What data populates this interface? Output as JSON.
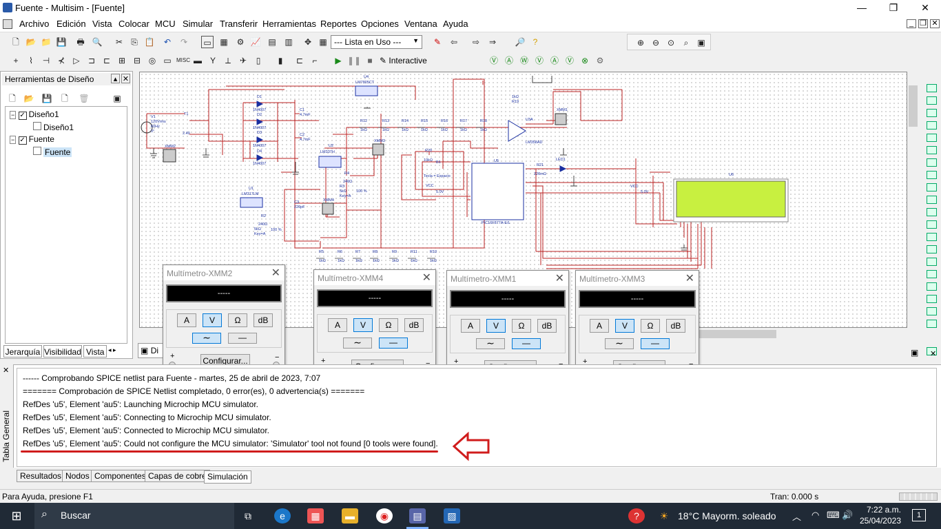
{
  "window": {
    "title": "Fuente - Multisim - [Fuente]",
    "min": "—",
    "max": "❐",
    "close": "✕"
  },
  "menu": [
    "Archivo",
    "Edición",
    "Vista",
    "Colocar",
    "MCU",
    "Simular",
    "Transferir",
    "Herramientas",
    "Reportes",
    "Opciones",
    "Ventana",
    "Ayuda"
  ],
  "toolbar": {
    "combo": "--- Lista en Uso ---",
    "interactive": "Interactive"
  },
  "design_tools": {
    "title": "Herramientas de Diseño",
    "tree": [
      "Diseño1",
      "Diseño1",
      "Fuente",
      "Fuente"
    ],
    "tabs": [
      "Jerarquía",
      "Visibilidad",
      "Vista d"
    ]
  },
  "schematic": {
    "tab": "Di",
    "labels": {
      "v1": "V1",
      "v1a": "120Vrms",
      "v1b": "60Hz",
      "v1c": "0°",
      "t1": "T1",
      "t1v": "2.49",
      "d1": "D1",
      "d2": "D2",
      "d3": "D3",
      "d4": "D4",
      "dmodel": "1N4007",
      "c1": "C1",
      "c1v": "4.7mF",
      "c2": "C2",
      "c2v": "4.7mF",
      "c3": "C3",
      "c3v": "220pF",
      "u4": "U4",
      "u4m": "LM7805CT",
      "u2": "U2",
      "u2m": "LM337H",
      "u1": "U1",
      "u1m": "LM317LM",
      "r4": "R4",
      "r4v": "240Ω",
      "r3": "R3",
      "r3v": "5kΩ",
      "r3k": "Key=A",
      "r3p": "100 %",
      "r2": "R2",
      "r2v": "240Ω",
      "r1": "R1",
      "r1v": "5kΩ",
      "r1k": "Key=A",
      "r1p": "100 %",
      "r12": "R12",
      "r13": "R13",
      "r14": "R14",
      "r15": "R15",
      "r16": "R16",
      "r17": "R17",
      "r18": "R18",
      "kohm": "1kΩ",
      "r5": "R5",
      "r6": "R6",
      "r7": "R7",
      "r8": "R8",
      "r9": "R9",
      "r11": "R11",
      "r10": "R10",
      "r19": "R19",
      "r19v": "1kΩ",
      "u3": "U3A",
      "u3m": "LM358AD",
      "xmm1": "XMM1",
      "xmm2": "XMM2",
      "xmm3": "XMM3",
      "xmm4": "XMM4",
      "r20": "R20",
      "r20v": "10kΩ",
      "b1": "B1",
      "b1k": "Tecla = Espacio",
      "vcc": "VCC",
      "vccv": "5.0V",
      "u5": "U5",
      "u5m": "PIC16F877A-E/L",
      "led1": "LED1",
      "r21": "R21",
      "r21v": "220mΩ",
      "u6": "U6",
      "vcc2": "VCC",
      "vcc2v": "5.0V"
    }
  },
  "multimeters": [
    {
      "title": "Multímetro-XMM2",
      "display": "-----",
      "buttons": [
        "A",
        "V",
        "Ω",
        "dB"
      ],
      "active": 1,
      "wave_active": 0,
      "config": "Configurar...",
      "plus": "+",
      "minus": "−"
    },
    {
      "title": "Multímetro-XMM4",
      "display": "-----",
      "buttons": [
        "A",
        "V",
        "Ω",
        "dB"
      ],
      "active": 1,
      "wave_active": 1,
      "config": "Configurar...",
      "plus": "+",
      "minus": "−"
    },
    {
      "title": "Multímetro-XMM1",
      "display": "-----",
      "buttons": [
        "A",
        "V",
        "Ω",
        "dB"
      ],
      "active": 1,
      "wave_active": 1,
      "config": "Configurar...",
      "plus": "+",
      "minus": "−"
    },
    {
      "title": "Multímetro-XMM3",
      "display": "-----",
      "buttons": [
        "A",
        "V",
        "Ω",
        "dB"
      ],
      "active": 1,
      "wave_active": 1,
      "config": "Configurar...",
      "plus": "+",
      "minus": "−"
    }
  ],
  "output": {
    "vertical_tab": "Tabla General",
    "lines": [
      "------ Comprobando SPICE netlist para Fuente - martes, 25 de abril de 2023, 7:07",
      "======= Comprobación de SPICE Netlist completado, 0 error(es), 0 advertencia(s) =======",
      "RefDes 'u5', Element 'au5': Launching Microchip MCU simulator.",
      "RefDes 'u5', Element 'au5': Connecting to Microchip MCU simulator.",
      "RefDes 'u5', Element 'au5': Connected to Microchip MCU simulator.",
      "RefDes 'u5', Element 'au5': Could not configure the MCU simulator: 'Simulator' tool not found [0 tools were found]."
    ],
    "tabs": [
      "Resultados",
      "Nodos",
      "Componentes",
      "Capas de cobre",
      "Simulación"
    ]
  },
  "status": {
    "help": "Para Ayuda, presione F1",
    "tran": "Tran: 0.000 s"
  },
  "taskbar": {
    "search": "Buscar",
    "weather": "18°C  Mayorm. soleado",
    "time": "7:22 a.m.",
    "date": "25/04/2023",
    "notif": "1"
  }
}
